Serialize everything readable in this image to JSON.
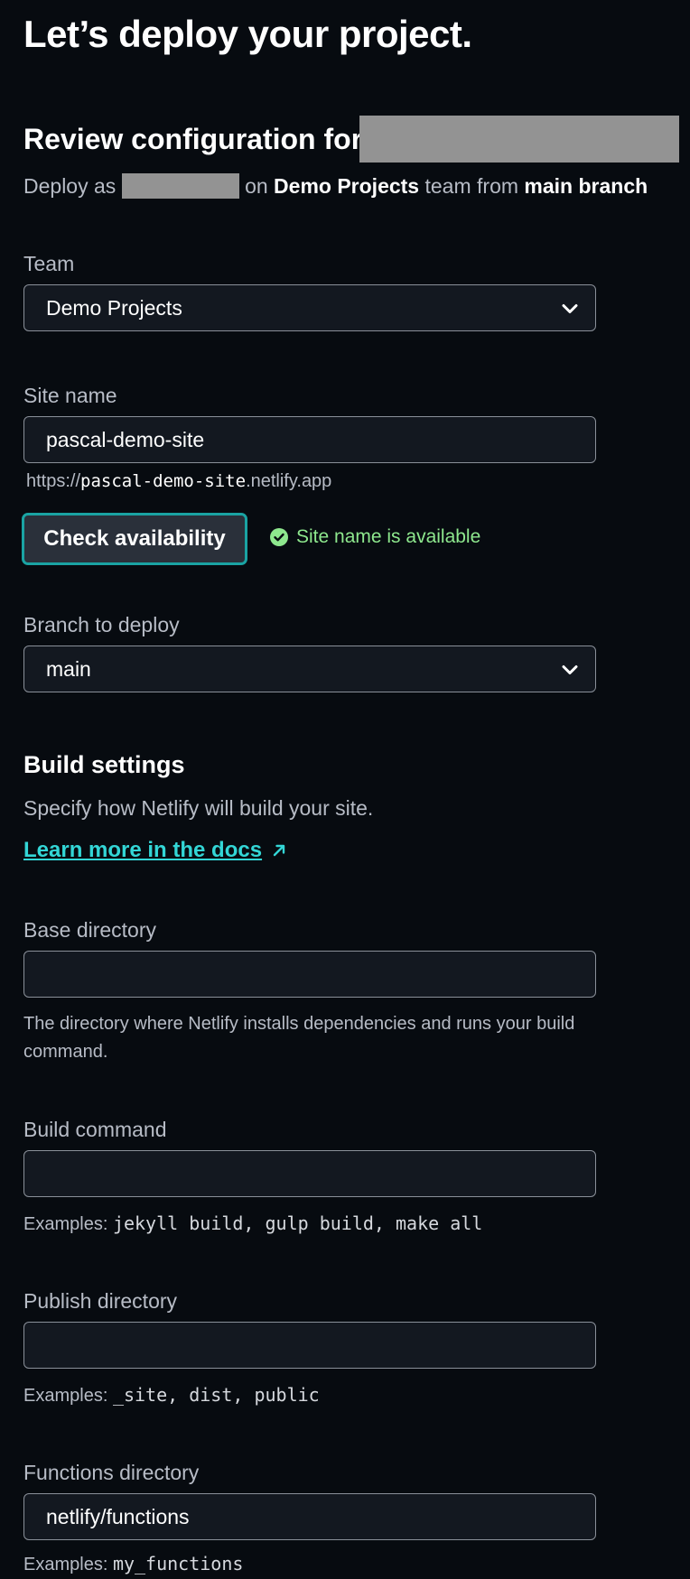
{
  "header": {
    "title": "Let’s deploy your project.",
    "review_prefix": "Review configuration for",
    "deploy_as_prefix": "Deploy as",
    "deploy_on": "on",
    "team_name": "Demo Projects",
    "team_from": "team from",
    "branch_phrase": "main branch"
  },
  "team": {
    "label": "Team",
    "value": "Demo Projects"
  },
  "site_name": {
    "label": "Site name",
    "value": "pascal-demo-site",
    "url_prefix": "https://",
    "url_slug": "pascal-demo-site",
    "url_suffix": ".netlify.app",
    "check_button": "Check availability",
    "availability_message": "Site name is available"
  },
  "branch": {
    "label": "Branch to deploy",
    "value": "main"
  },
  "build_settings": {
    "title": "Build settings",
    "description": "Specify how Netlify will build your site.",
    "learn_more": "Learn more in the docs",
    "base_directory": {
      "label": "Base directory",
      "value": "",
      "help": "The directory where Netlify installs dependencies and runs your build command."
    },
    "build_command": {
      "label": "Build command",
      "value": "",
      "help_prefix": "Examples:",
      "help_examples": "jekyll build, gulp build, make all"
    },
    "publish_directory": {
      "label": "Publish directory",
      "value": "",
      "help_prefix": "Examples:",
      "help_examples": "_site, dist, public"
    },
    "functions_directory": {
      "label": "Functions directory",
      "value": "netlify/functions",
      "help_prefix": "Examples:",
      "help_examples": "my_functions"
    }
  },
  "colors": {
    "background": "#070b10",
    "field_bg": "#131820",
    "accent_teal": "#33d6d6",
    "success_green": "#8ee88e",
    "redaction_gray": "#939393"
  }
}
